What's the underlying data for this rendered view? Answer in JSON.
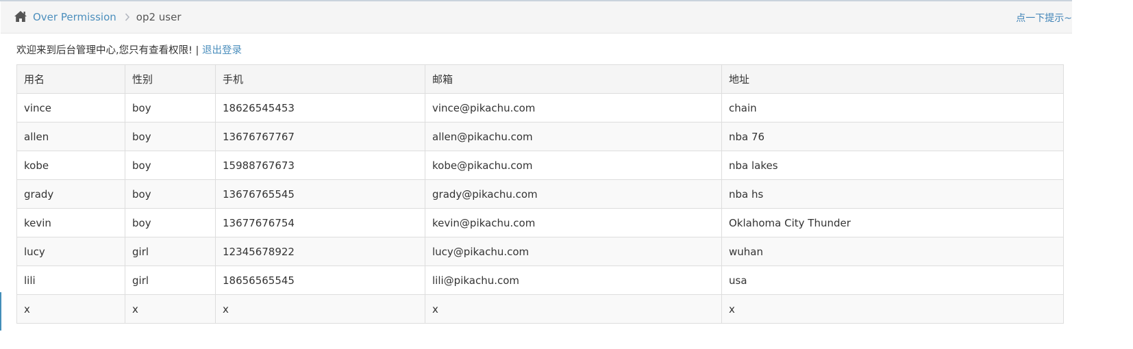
{
  "breadcrumb": {
    "home_link": "Over Permission",
    "current": "op2 user",
    "hint": "点一下提示~"
  },
  "welcome": {
    "message": "欢迎来到后台管理中心,您只有查看权限! | ",
    "logout": "退出登录"
  },
  "table": {
    "headers": [
      "用名",
      "性别",
      "手机",
      "邮箱",
      "地址"
    ],
    "rows": [
      [
        "vince",
        "boy",
        "18626545453",
        "vince@pikachu.com",
        "chain"
      ],
      [
        "allen",
        "boy",
        "13676767767",
        "allen@pikachu.com",
        "nba 76"
      ],
      [
        "kobe",
        "boy",
        "15988767673",
        "kobe@pikachu.com",
        "nba lakes"
      ],
      [
        "grady",
        "boy",
        "13676765545",
        "grady@pikachu.com",
        "nba hs"
      ],
      [
        "kevin",
        "boy",
        "13677676754",
        "kevin@pikachu.com",
        "Oklahoma City Thunder"
      ],
      [
        "lucy",
        "girl",
        "12345678922",
        "lucy@pikachu.com",
        "wuhan"
      ],
      [
        "lili",
        "girl",
        "18656565545",
        "lili@pikachu.com",
        "usa"
      ],
      [
        "x",
        "x",
        "x",
        "x",
        "x"
      ]
    ]
  },
  "icons": {
    "home": "home-icon",
    "separator": "chevron-right-icon"
  },
  "colors": {
    "link": "#4c8fbd",
    "accent": "#438eb9"
  }
}
